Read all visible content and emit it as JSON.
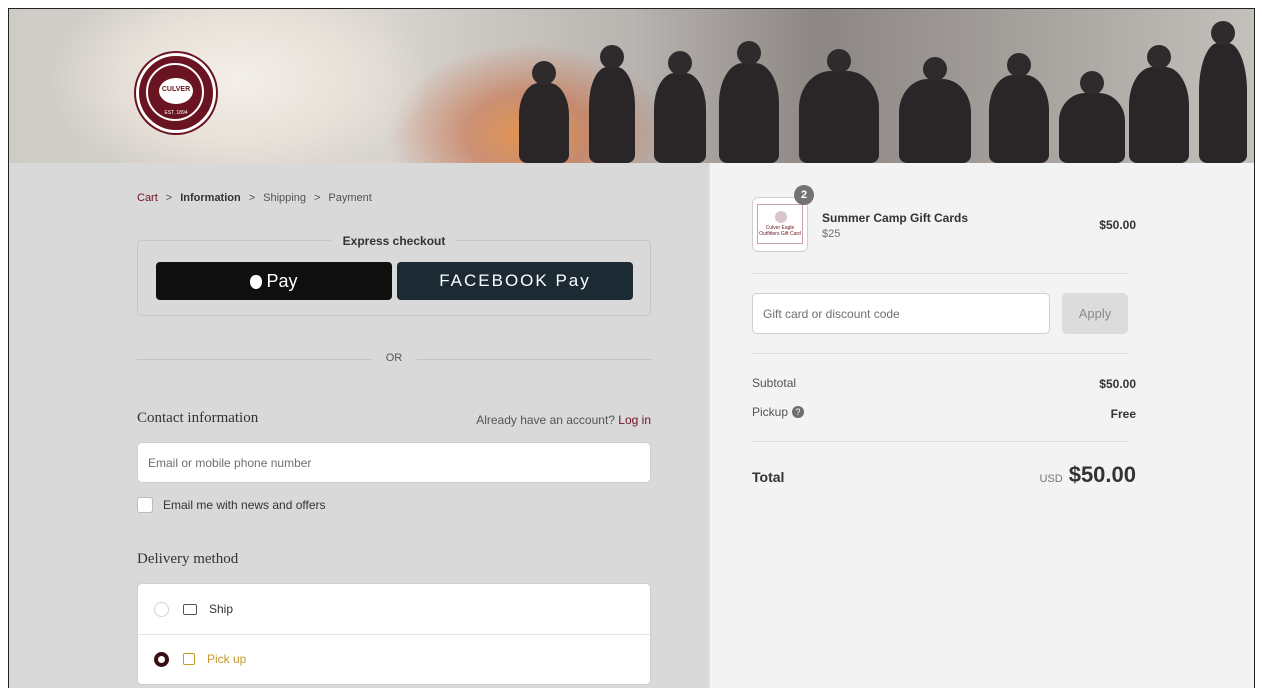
{
  "header": {
    "logo": {
      "text_ring": "CULVER ACADEMIES",
      "word": "CULVER",
      "est": "EST. 1894"
    }
  },
  "breadcrumb": {
    "items": [
      "Cart",
      "Information",
      "Shipping",
      "Payment"
    ],
    "separator": ">"
  },
  "express": {
    "title": "Express checkout",
    "apple_pay": "Pay",
    "facebook_pay": "FACEBOOK Pay"
  },
  "divider": {
    "or": "OR"
  },
  "contact": {
    "title": "Contact information",
    "account_prompt": "Already have an account?",
    "login": "Log in",
    "email_placeholder": "Email or mobile phone number",
    "newsletter_label": "Email me with news and offers"
  },
  "delivery": {
    "title": "Delivery method",
    "options": [
      {
        "label": "Ship",
        "selected": false
      },
      {
        "label": "Pick up",
        "selected": true
      }
    ]
  },
  "summary": {
    "item": {
      "quantity": "2",
      "name": "Summer Camp Gift Cards",
      "variant": "$25",
      "price": "$50.00",
      "thumb_text": "Culver Eagle Outfitters Gift Card"
    },
    "discount_placeholder": "Gift card or discount code",
    "apply": "Apply",
    "subtotal_label": "Subtotal",
    "subtotal": "$50.00",
    "pickup_label": "Pickup",
    "pickup": "Free",
    "total_label": "Total",
    "currency": "USD",
    "total": "$50.00"
  },
  "colors": {
    "accent": "#6b1421",
    "pickup": "#c79a2b",
    "facebook_pay": "#1c2a33"
  }
}
